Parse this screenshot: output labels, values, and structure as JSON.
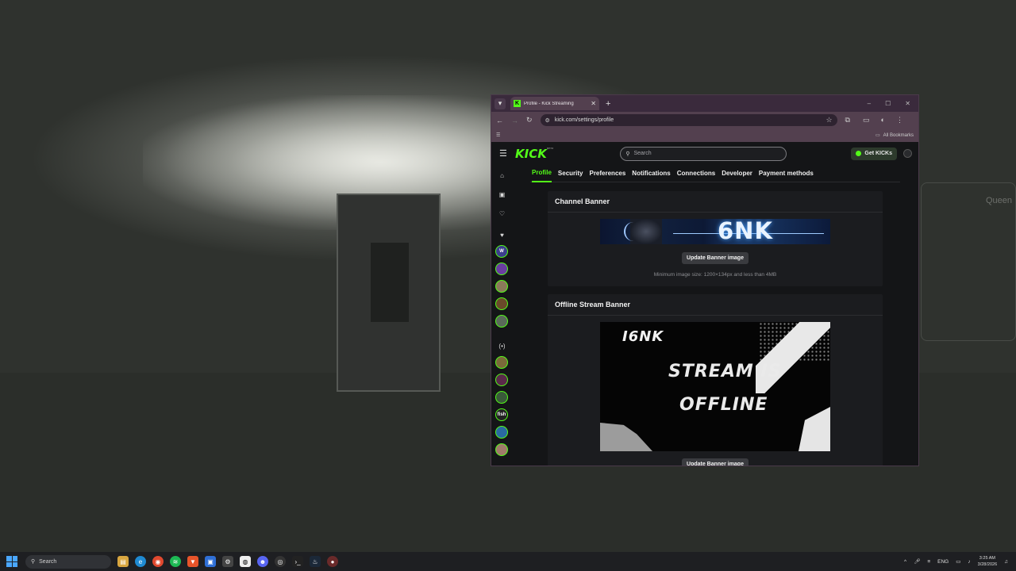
{
  "desktop": {
    "wall_text": "Queen"
  },
  "browser": {
    "tab_title": "Profile - Kick Streaming",
    "tab_favicon": "K",
    "url": "kick.com/settings/profile",
    "bookmarks_label": "All Bookmarks",
    "window_controls": [
      "–",
      "☐",
      "✕"
    ]
  },
  "kick": {
    "logo": "KICK",
    "logo_sup": "BETA",
    "search_placeholder": "Search",
    "get_kicks_label": "Get KICKs",
    "settings_tabs": [
      {
        "label": "Profile",
        "active": true
      },
      {
        "label": "Security",
        "active": false
      },
      {
        "label": "Preferences",
        "active": false
      },
      {
        "label": "Notifications",
        "active": false
      },
      {
        "label": "Connections",
        "active": false
      },
      {
        "label": "Developer",
        "active": false
      },
      {
        "label": "Payment methods",
        "active": false
      }
    ],
    "channel_banner": {
      "title": "Channel Banner",
      "banner_text": "6NK",
      "button_label": "Update Banner image",
      "hint": "Minimum image size: 1200×134px and less than 4MB"
    },
    "offline_banner": {
      "title": "Offline Stream Banner",
      "name_text": "I6NK",
      "line1": "STREAM IS",
      "line2": "OFFLINE",
      "button_label": "Update Banner image"
    },
    "sidebar_avatars": [
      "W",
      "",
      "",
      "",
      "",
      "",
      "",
      "",
      "fish",
      "",
      ""
    ],
    "accent": "#53fc18"
  },
  "taskbar": {
    "search_placeholder": "Search",
    "language": "ENG",
    "time": "3:25 AM",
    "date": "3/28/2026"
  }
}
